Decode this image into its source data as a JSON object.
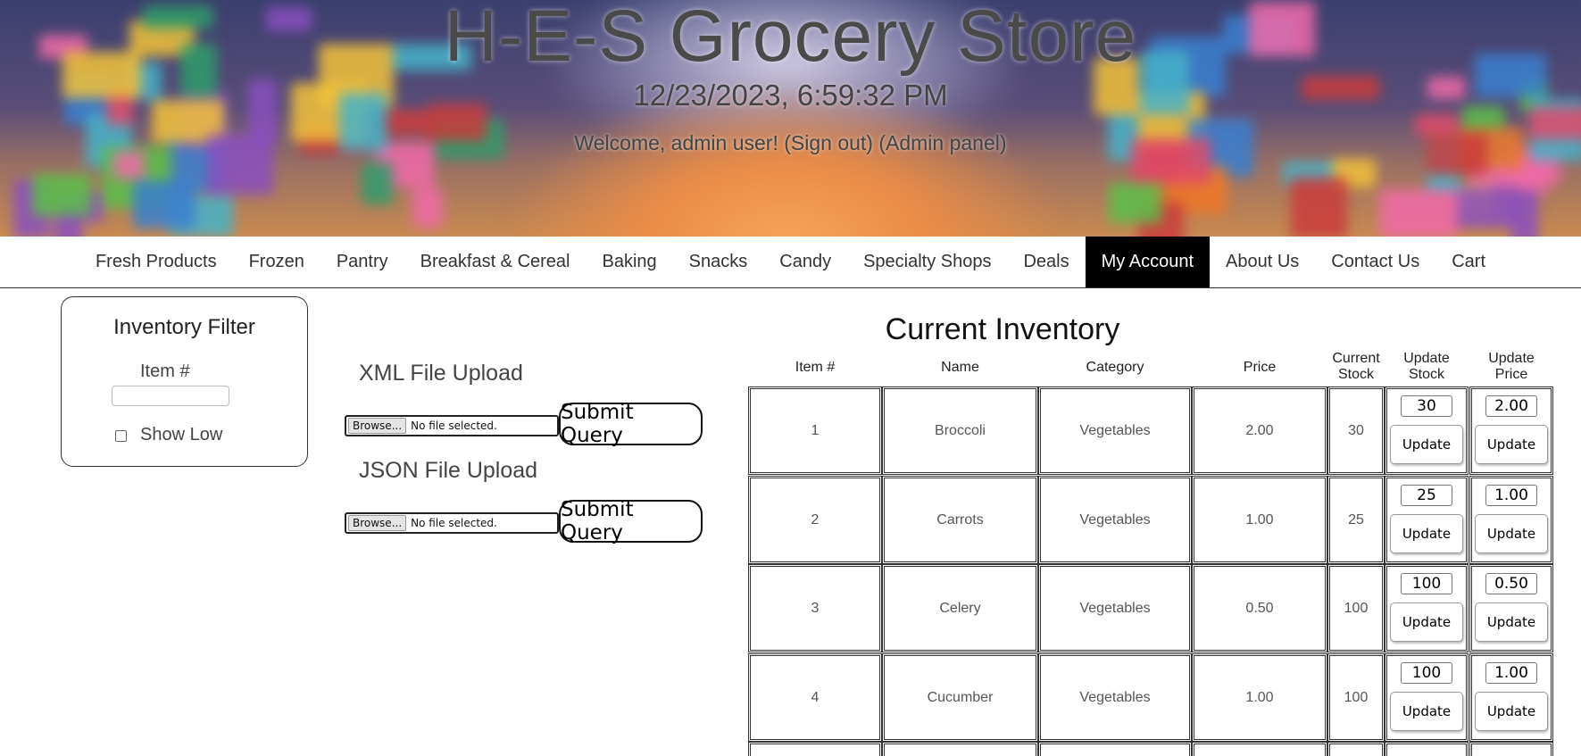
{
  "header": {
    "title": "H-E-S Grocery Store",
    "clock": "12/23/2023, 6:59:32 PM",
    "welcome": "Welcome, admin user!",
    "sign_out": "(Sign out)",
    "admin_panel": "(Admin panel)"
  },
  "nav": {
    "items": [
      "Fresh Products",
      "Frozen",
      "Pantry",
      "Breakfast & Cereal",
      "Baking",
      "Snacks",
      "Candy",
      "Specialty Shops",
      "Deals",
      "My Account",
      "About Us",
      "Contact Us",
      "Cart"
    ],
    "active": "My Account"
  },
  "filter": {
    "title": "Inventory Filter",
    "item_label": "Item #",
    "item_value": "",
    "show_low_label": "Show Low",
    "show_low_checked": false
  },
  "uploads": {
    "xml": {
      "title": "XML File Upload",
      "browse": "Browse...",
      "status": "No file selected.",
      "submit": "Submit Query"
    },
    "json": {
      "title": "JSON File Upload",
      "browse": "Browse...",
      "status": "No file selected.",
      "submit": "Submit Query"
    }
  },
  "inventory": {
    "title": "Current Inventory",
    "headers": {
      "item": "Item #",
      "name": "Name",
      "category": "Category",
      "price": "Price",
      "stock_line1": "Current",
      "stock_line2": "Stock",
      "upd_stock_line1": "Update",
      "upd_stock_line2": "Stock",
      "upd_price_line1": "Update",
      "upd_price_line2": "Price"
    },
    "update_label": "Update",
    "rows": [
      {
        "item": "1",
        "name": "Broccoli",
        "category": "Vegetables",
        "price": "2.00",
        "stock": "30",
        "stock_input": "30",
        "price_input": "2.00"
      },
      {
        "item": "2",
        "name": "Carrots",
        "category": "Vegetables",
        "price": "1.00",
        "stock": "25",
        "stock_input": "25",
        "price_input": "1.00"
      },
      {
        "item": "3",
        "name": "Celery",
        "category": "Vegetables",
        "price": "0.50",
        "stock": "100",
        "stock_input": "100",
        "price_input": "0.50"
      },
      {
        "item": "4",
        "name": "Cucumber",
        "category": "Vegetables",
        "price": "1.00",
        "stock": "100",
        "stock_input": "100",
        "price_input": "1.00"
      }
    ]
  },
  "colors": {
    "nav_active_bg": "#000000",
    "nav_active_text": "#ffffff",
    "text": "#333333"
  }
}
